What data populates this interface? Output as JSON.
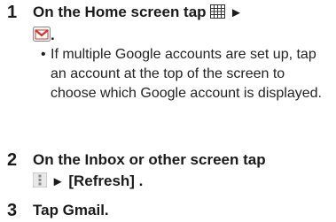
{
  "steps": [
    {
      "number": "1",
      "text_before": "On the Home screen tap",
      "arrow": "►",
      "text_end": ".",
      "icons": [
        "apps-grid-icon",
        "gmail-envelope-icon"
      ],
      "bullet": "If multiple Google accounts are set up, tap an account at the top of the screen to choose which Google account is displayed."
    },
    {
      "number": "2",
      "text_before": "On the Inbox or other screen tap",
      "arrow": "►",
      "text_after": "[Refresh] .",
      "icons": [
        "menu-dots-icon"
      ]
    },
    {
      "number": "3",
      "text": "Tap Gmail."
    }
  ],
  "colors": {
    "text": "#1a1a1a",
    "gmail_red": "#d8322a",
    "icon_gray": "#9a9a9a"
  }
}
